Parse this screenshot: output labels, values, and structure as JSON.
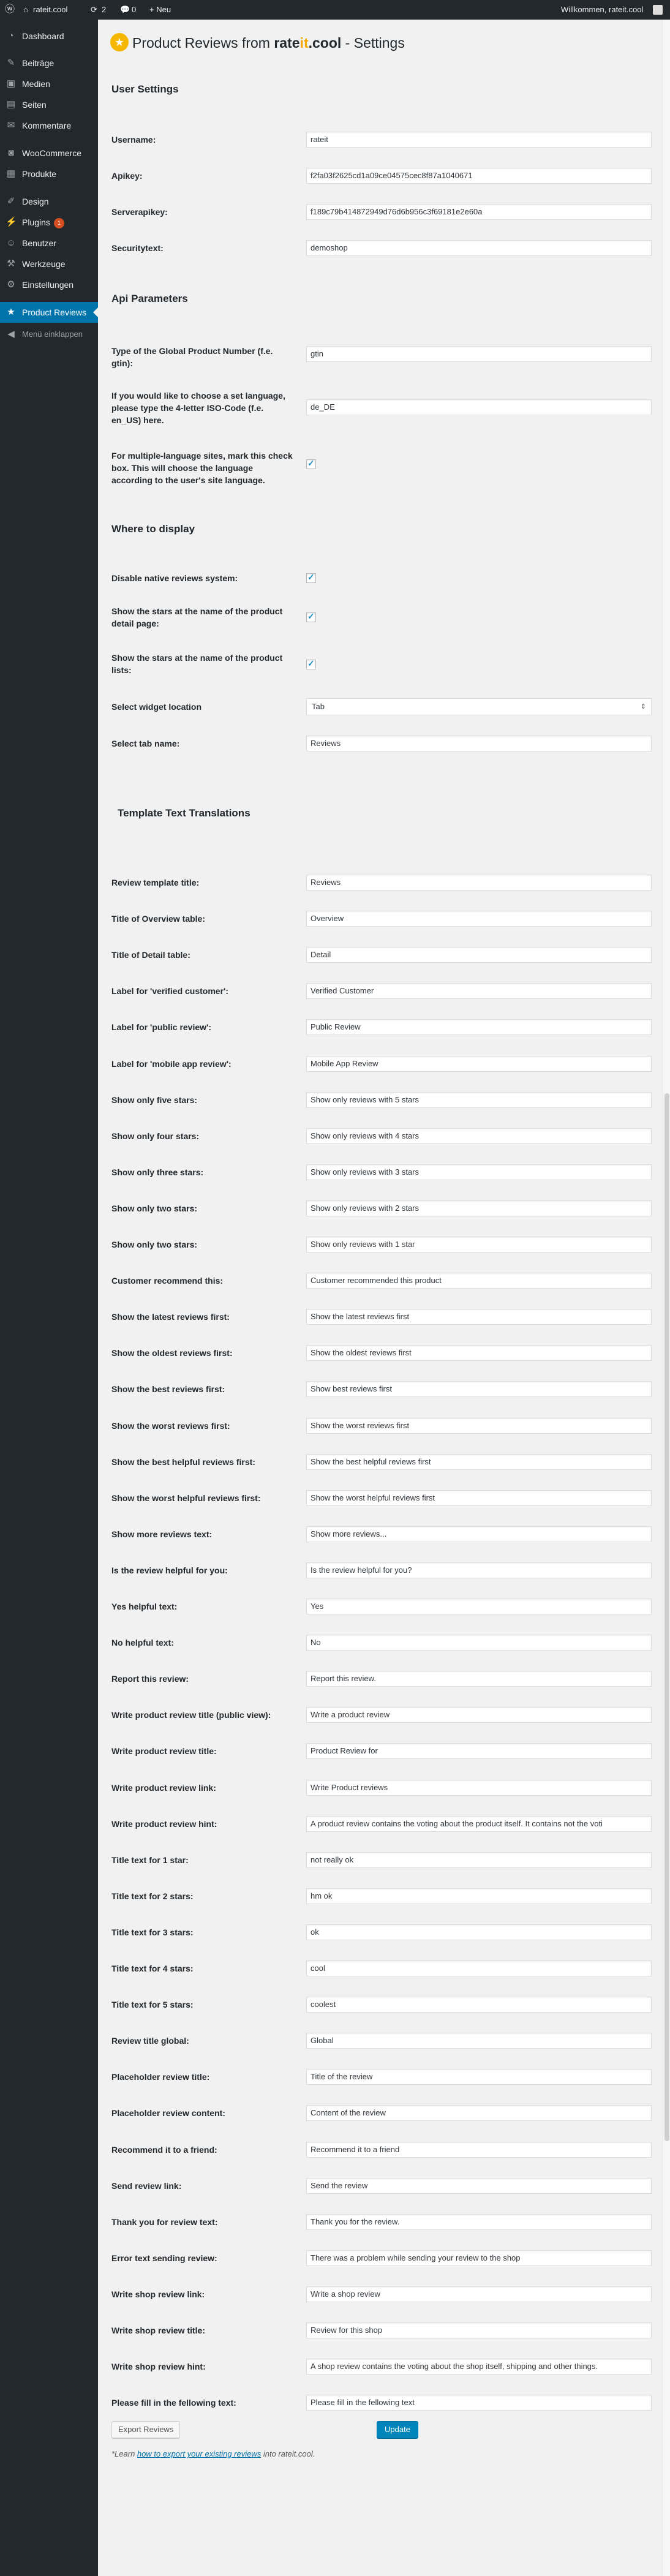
{
  "adminbar": {
    "site_name": "rateit.cool",
    "updates_count": "2",
    "comments_count": "0",
    "new_label": "+ Neu",
    "greeting": "Willkommen, rateit.cool"
  },
  "sidebar": {
    "items": [
      {
        "label": "Dashboard",
        "icon": "dashboard-icon"
      },
      {
        "label": "Beiträge",
        "icon": "pin-icon"
      },
      {
        "label": "Medien",
        "icon": "media-icon"
      },
      {
        "label": "Seiten",
        "icon": "pages-icon"
      },
      {
        "label": "Kommentare",
        "icon": "comments-icon"
      },
      {
        "label": "WooCommerce",
        "icon": "woocommerce-icon"
      },
      {
        "label": "Produkte",
        "icon": "products-icon"
      },
      {
        "label": "Design",
        "icon": "brush-icon"
      },
      {
        "label": "Plugins",
        "icon": "plugin-icon",
        "badge": "1"
      },
      {
        "label": "Benutzer",
        "icon": "users-icon"
      },
      {
        "label": "Werkzeuge",
        "icon": "tools-icon"
      },
      {
        "label": "Einstellungen",
        "icon": "settings-icon"
      },
      {
        "label": "Product Reviews",
        "icon": "star-icon",
        "current": true
      },
      {
        "label": "Menü einklappen",
        "icon": "collapse-icon"
      }
    ]
  },
  "page": {
    "title_prefix": "Product Reviews from ",
    "brand_rate": "rate",
    "brand_it": "it",
    "brand_cool": ".cool",
    "title_suffix": " - Settings"
  },
  "sections": {
    "user_settings": "User Settings",
    "api_parameters": "Api Parameters",
    "where_to_display": "Where to display",
    "template_translations": "Template Text Translations"
  },
  "user_settings": {
    "username_label": "Username:",
    "username_value": "rateit",
    "apikey_label": "Apikey:",
    "apikey_value": "f2fa03f2625cd1a09ce04575cec8f87a1040671",
    "serverapikey_label": "Serverapikey:",
    "serverapikey_value": "f189c79b414872949d76d6b956c3f69181e2e60a",
    "securitytext_label": "Securitytext:",
    "securitytext_value": "demoshop"
  },
  "api_parameters": {
    "gpn_label": "Type of the Global Product Number (f.e. gtin):",
    "gpn_value": "gtin",
    "lang_label": "If you would like to choose a set language, please type the 4-letter ISO-Code (f.e. en_US) here.",
    "lang_value": "de_DE",
    "multi_label": "For multiple-language sites, mark this check box. This will choose the language according to the user's site language."
  },
  "display": {
    "disable_native_label": "Disable native reviews system:",
    "stars_detail_label": "Show the stars at the name of the product detail page:",
    "stars_lists_label": "Show the stars at the name of the product lists:",
    "widget_location_label": "Select widget location",
    "widget_location_value": "Tab",
    "tab_name_label": "Select tab name:",
    "tab_name_value": "Reviews"
  },
  "translations": [
    {
      "label": "Review template title:",
      "value": "Reviews"
    },
    {
      "label": "Title of Overview table:",
      "value": "Overview"
    },
    {
      "label": "Title of Detail table:",
      "value": "Detail"
    },
    {
      "label": "Label for 'verified customer':",
      "value": "Verified Customer"
    },
    {
      "label": "Label for 'public review':",
      "value": "Public Review"
    },
    {
      "label": "Label for 'mobile app review':",
      "value": "Mobile App Review"
    },
    {
      "label": "Show only five stars:",
      "value": "Show only reviews with 5 stars"
    },
    {
      "label": "Show only four stars:",
      "value": "Show only reviews with 4 stars"
    },
    {
      "label": "Show only three stars:",
      "value": "Show only reviews with 3 stars"
    },
    {
      "label": "Show only two stars:",
      "value": "Show only reviews with 2 stars"
    },
    {
      "label": "Show only two stars:",
      "value": "Show only reviews with 1 star"
    },
    {
      "label": "Customer recommend this:",
      "value": "Customer recommended this product"
    },
    {
      "label": "Show the latest reviews first:",
      "value": "Show the latest reviews first"
    },
    {
      "label": "Show the oldest reviews first:",
      "value": "Show the oldest reviews first"
    },
    {
      "label": "Show the best reviews first:",
      "value": "Show best reviews first"
    },
    {
      "label": "Show the worst reviews first:",
      "value": "Show the worst reviews first"
    },
    {
      "label": "Show the best helpful reviews first:",
      "value": "Show the best helpful reviews first"
    },
    {
      "label": "Show the worst helpful reviews first:",
      "value": "Show the worst helpful reviews first"
    },
    {
      "label": "Show more reviews text:",
      "value": "Show more reviews..."
    },
    {
      "label": "Is the review helpful for you:",
      "value": "Is the review helpful for you?"
    },
    {
      "label": "Yes helpful text:",
      "value": "Yes"
    },
    {
      "label": "No helpful text:",
      "value": "No"
    },
    {
      "label": "Report this review:",
      "value": "Report this review."
    },
    {
      "label": "Write product review title (public view):",
      "value": "Write a product review"
    },
    {
      "label": "Write product review title:",
      "value": "Product Review for"
    },
    {
      "label": "Write product review link:",
      "value": "Write Product reviews"
    },
    {
      "label": "Write product review hint:",
      "value": "A product review contains the voting about the product itself. It contains not the voti"
    },
    {
      "label": "Title text for 1 star:",
      "value": "not really ok"
    },
    {
      "label": "Title text for 2 stars:",
      "value": "hm ok"
    },
    {
      "label": "Title text for 3 stars:",
      "value": "ok"
    },
    {
      "label": "Title text for 4 stars:",
      "value": "cool"
    },
    {
      "label": "Title text for 5 stars:",
      "value": "coolest"
    },
    {
      "label": "Review title global:",
      "value": "Global"
    },
    {
      "label": "Placeholder review title:",
      "value": "Title of the review"
    },
    {
      "label": "Placeholder review content:",
      "value": "Content of the review"
    },
    {
      "label": "Recommend it to a friend:",
      "value": "Recommend it to a friend"
    },
    {
      "label": "Send review link:",
      "value": "Send the review"
    },
    {
      "label": "Thank you for review text:",
      "value": "Thank you for the review."
    },
    {
      "label": "Error text sending review:",
      "value": "There was a problem while sending your review to the shop"
    },
    {
      "label": "Write shop review link:",
      "value": "Write a shop review"
    },
    {
      "label": "Write shop review title:",
      "value": "Review for this shop"
    },
    {
      "label": "Write shop review hint:",
      "value": "A shop review contains the voting about the shop itself, shipping and other things."
    },
    {
      "label": "Please fill in the fellowing text:",
      "value": "Please fill in the fellowing text"
    }
  ],
  "actions": {
    "export_label": "Export Reviews",
    "update_label": "Update",
    "hint_prefix": "*Learn ",
    "hint_link": "how to export your existing reviews",
    "hint_suffix": " into rateit.cool."
  },
  "scroll": {
    "thumb_top_fraction": 0.42,
    "thumb_size_fraction": 0.41
  }
}
